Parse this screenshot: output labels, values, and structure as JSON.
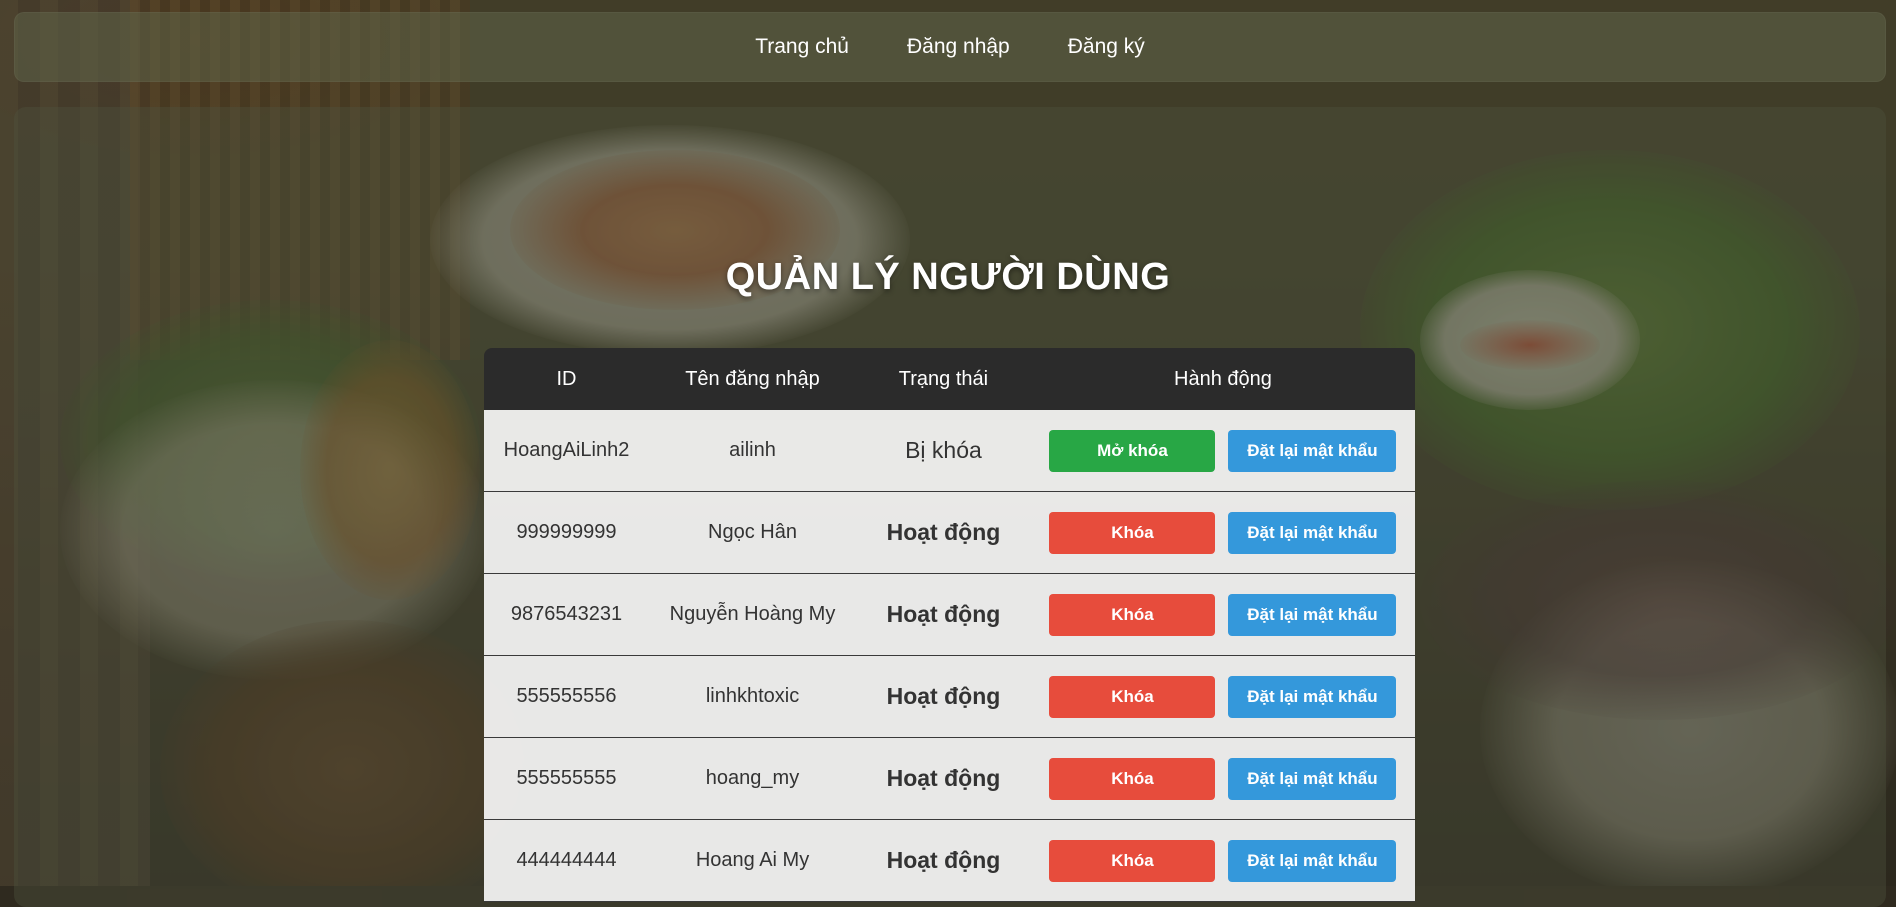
{
  "nav": {
    "items": [
      {
        "label": "Trang chủ"
      },
      {
        "label": "Đăng nhập"
      },
      {
        "label": "Đăng ký"
      }
    ]
  },
  "page": {
    "title": "QUẢN LÝ NGƯỜI DÙNG"
  },
  "table": {
    "headers": {
      "id": "ID",
      "username": "Tên đăng nhập",
      "status": "Trạng thái",
      "action": "Hành động"
    },
    "rows": [
      {
        "id": "HoangAiLinh2",
        "username": "ailinh",
        "status": "Bị khóa",
        "toggle_label": "Mở khóa",
        "reset_label": "Đặt lại mật khẩu"
      },
      {
        "id": "999999999",
        "username": "Ngọc Hân",
        "status": "Hoạt động",
        "toggle_label": "Khóa",
        "reset_label": "Đặt lại mật khẩu"
      },
      {
        "id": "9876543231",
        "username": "Nguyễn Hoàng My",
        "status": "Hoạt động",
        "toggle_label": "Khóa",
        "reset_label": "Đặt lại mật khẩu"
      },
      {
        "id": "555555556",
        "username": "linhkhtoxic",
        "status": "Hoạt động",
        "toggle_label": "Khóa",
        "reset_label": "Đặt lại mật khẩu"
      },
      {
        "id": "555555555",
        "username": "hoang_my",
        "status": "Hoạt động",
        "toggle_label": "Khóa",
        "reset_label": "Đặt lại mật khẩu"
      },
      {
        "id": "444444444",
        "username": "Hoang Ai My",
        "status": "Hoạt động",
        "toggle_label": "Khóa",
        "reset_label": "Đặt lại mật khẩu"
      }
    ]
  },
  "colors": {
    "locked_status": "#e03a48",
    "active_status": "#27a045",
    "unlock_button": "#28a745",
    "lock_button": "#e74c3c",
    "reset_button": "#3498db",
    "table_header": "#2b2b2b"
  }
}
